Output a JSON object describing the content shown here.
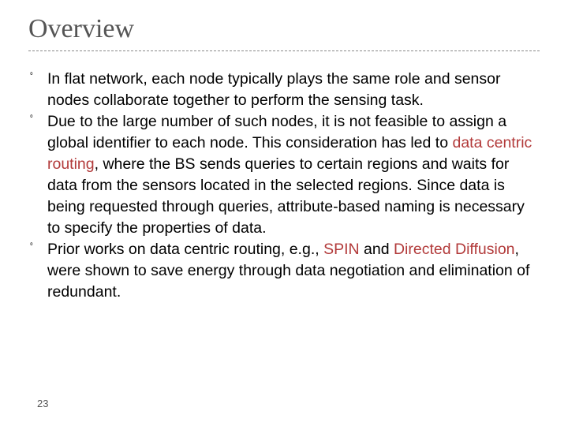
{
  "title": "Overview",
  "bullets": [
    {
      "segments": [
        {
          "text": "In flat network, each node typically plays the same role and sensor nodes collaborate together to perform the sensing task."
        }
      ]
    },
    {
      "segments": [
        {
          "text": "Due to the large number of such nodes, it is not feasible to assign a global identifier to each node. This consideration has led to "
        },
        {
          "text": "data centric routing",
          "accent": true
        },
        {
          "text": ", where the BS sends queries to certain regions and waits for data from the sensors located in the selected regions. Since data is being requested through queries, attribute-based naming is necessary to specify the properties of data."
        }
      ]
    },
    {
      "segments": [
        {
          "text": "Prior works on data centric routing, e.g., "
        },
        {
          "text": "SPIN",
          "accent": true
        },
        {
          "text": " and "
        },
        {
          "text": "Directed Diffusion",
          "accent": true
        },
        {
          "text": ", were shown to save energy through data negotiation and elimination of redundant."
        }
      ]
    }
  ],
  "bullet_glyph": "ﾟ",
  "page_number": "23"
}
